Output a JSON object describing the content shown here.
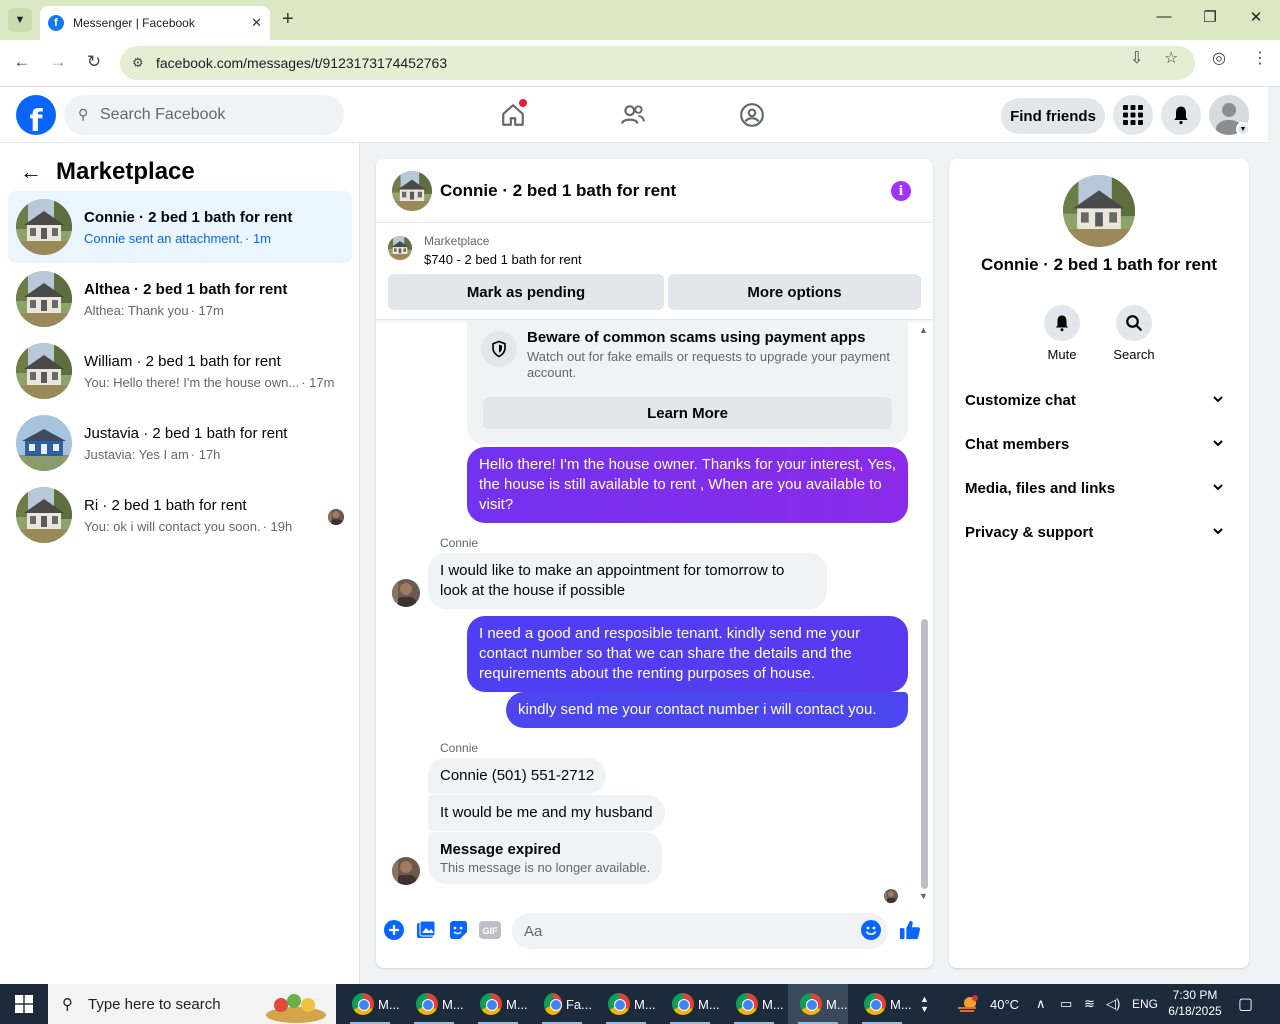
{
  "browser": {
    "tab_title": "Messenger | Facebook",
    "url": "facebook.com/messages/t/9123173174452763"
  },
  "fb": {
    "search_placeholder": "Search Facebook",
    "find_friends": "Find friends"
  },
  "left": {
    "title": "Marketplace",
    "conversations": [
      {
        "name": "Connie · 2 bed 1 bath for rent",
        "preview": "Connie sent an attachment.",
        "time": "· 1m",
        "active": true
      },
      {
        "name": "Althea · 2 bed 1 bath for rent",
        "preview": "Althea: Thank you",
        "time": "· 17m"
      },
      {
        "name": "William · 2 bed 1 bath for rent",
        "preview": "You: Hello there! I'm the house own...",
        "time": "· 17m"
      },
      {
        "name": "Justavia · 2 bed 1 bath for rent",
        "preview": "Justavia: Yes I am",
        "time": "· 17h"
      },
      {
        "name": "Ri · 2 bed 1 bath for rent",
        "preview": "You: ok i will contact you soon.",
        "time": "· 19h"
      }
    ]
  },
  "chat": {
    "title": "Connie · 2 bed 1 bath for rent",
    "listing_label": "Marketplace",
    "listing_price": "$740 - 2 bed 1 bath for rent",
    "mark_pending": "Mark as pending",
    "more_options": "More options",
    "scam_title": "Beware of common scams using payment apps",
    "scam_desc": "Watch out for fake emails or requests to upgrade your payment account.",
    "learn_more": "Learn More",
    "messages": {
      "out1": "Hello there! I'm the house owner. Thanks for your interest, Yes, the house is still available to rent , When are you available to visit?",
      "sender1": "Connie",
      "in1": "I would like to make an appointment for tomorrow to look at the house if possible",
      "out2": "I need a good and resposible tenant.  kindly send me your contact number so that we can share the details and the requirements about the renting purposes of house.",
      "out3": "kindly  send  me your contact number  i will  contact you.",
      "sender2": "Connie",
      "in2": "Connie (501) 551-2712",
      "in3": "It would be me and my husband",
      "expired_title": "Message expired",
      "expired_sub": "This message is no longer available."
    },
    "composer_placeholder": "Aa"
  },
  "details": {
    "name": "Connie · 2 bed 1 bath for rent",
    "mute": "Mute",
    "search": "Search",
    "sections": [
      "Customize chat",
      "Chat members",
      "Media, files and links",
      "Privacy & support"
    ]
  },
  "taskbar": {
    "search_placeholder": "Type here to search",
    "apps": [
      "M...",
      "M...",
      "M...",
      "Fa...",
      "M...",
      "M...",
      "M...",
      "M...",
      "M..."
    ],
    "temperature": "40°C",
    "language": "ENG",
    "time": "7:30 PM",
    "date": "6/18/2025"
  },
  "colors": {
    "fb_blue": "#0866ff",
    "outgoing_purple": "#7b2ff0",
    "outgoing_blue": "#4b46ee",
    "active_conv": "#ebf5ff"
  }
}
